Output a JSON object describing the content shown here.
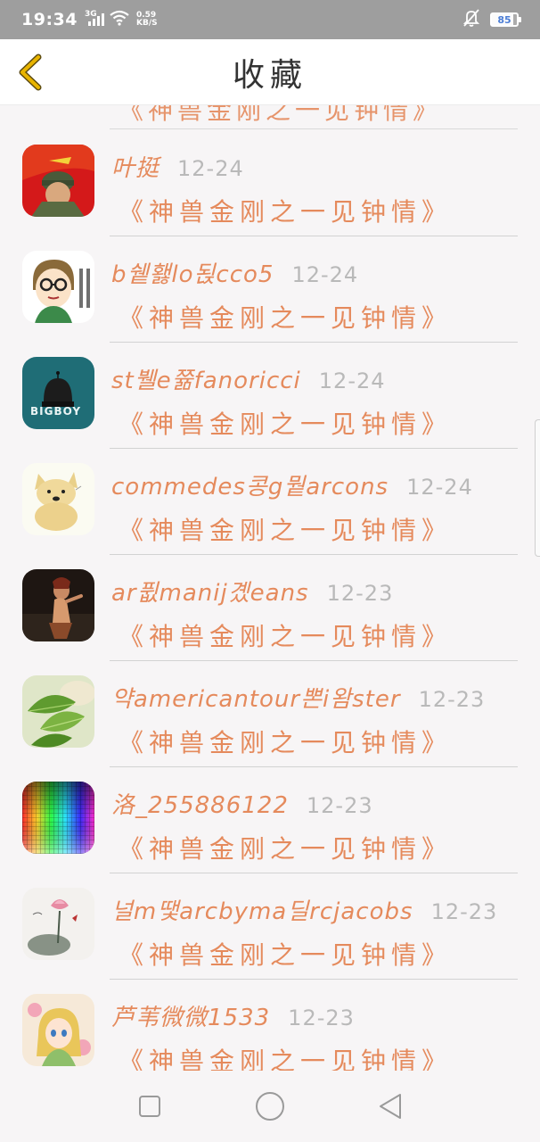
{
  "status_bar": {
    "time": "19:34",
    "network": "3G",
    "speed_value": "0.59",
    "speed_unit": "KB/S",
    "battery": "85",
    "battery_level": 0.85
  },
  "header": {
    "title": "收藏",
    "back_icon": "chevron-left-icon",
    "accent_color": "#e8b400"
  },
  "partial_row": {
    "subtitle": "《神兽金刚之一见钟情》"
  },
  "rows": [
    {
      "name": "叶挺",
      "date": "12-24",
      "subtitle": "《神兽金刚之一见钟情》",
      "avatar": "soldier-avatar"
    },
    {
      "name": "b쉩홿lo됝cco5",
      "date": "12-24",
      "subtitle": "《神兽金刚之一见钟情》",
      "avatar": "cartoon-glasses-avatar"
    },
    {
      "name": "st뷀e쯂fanoricci",
      "date": "12-24",
      "subtitle": "《神兽金刚之一见钟情》",
      "avatar": "bigboy-avatar"
    },
    {
      "name": "commedes콩g뭩arcons",
      "date": "12-24",
      "subtitle": "《神兽金刚之一见钟情》",
      "avatar": "doge-avatar"
    },
    {
      "name": "ar퓞manij곘eans",
      "date": "12-23",
      "subtitle": "《神兽金刚之一见钟情》",
      "avatar": "dancer-avatar"
    },
    {
      "name": "약americantour뽄i왐ster",
      "date": "12-23",
      "subtitle": "《神兽金刚之一见钟情》",
      "avatar": "leaf-avatar"
    },
    {
      "name": "洛_255886122",
      "date": "12-23",
      "subtitle": "《神兽金刚之一见钟情》",
      "avatar": "color-grid-avatar"
    },
    {
      "name": "널m땣arcbyma딜rcjacobs",
      "date": "12-23",
      "subtitle": "《神兽金刚之一见钟情》",
      "avatar": "ink-lotus-avatar"
    },
    {
      "name": "芦苇微微1533",
      "date": "12-23",
      "subtitle": "《神兽金刚之一见钟情》",
      "avatar": "anime-girl-avatar"
    }
  ],
  "nav_bar": {
    "recents_icon": "square-icon",
    "home_icon": "circle-icon",
    "back_icon": "triangle-back-icon"
  },
  "colors": {
    "name_text": "#e58a5c",
    "date_text": "#b9b9b9",
    "status_bar": "#9e9e9e",
    "battery_text": "#4c7ed6"
  }
}
